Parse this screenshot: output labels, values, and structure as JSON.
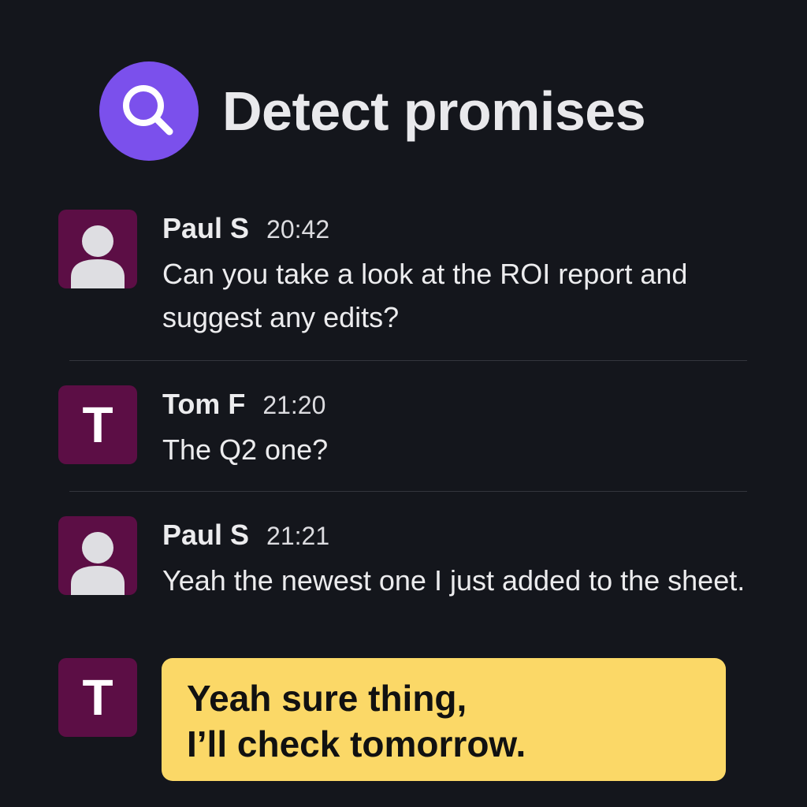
{
  "header": {
    "title": "Detect promises",
    "icon": "search-icon",
    "icon_bg_color": "#7b50ec"
  },
  "messages": [
    {
      "author": "Paul S",
      "time": "20:42",
      "text": "Can you take a look at the ROI report and suggest any edits?",
      "avatar": "person-icon"
    },
    {
      "author": "Tom F",
      "time": "21:20",
      "text": "The Q2 one?",
      "avatar_initial": "T"
    },
    {
      "author": "Paul S",
      "time": "21:21",
      "text": "Yeah the newest one I just added to the sheet.",
      "avatar": "person-icon"
    }
  ],
  "highlight": {
    "avatar_initial": "T",
    "line1": "Yeah sure thing,",
    "line2": "I’ll check tomorrow.",
    "color": "#fbd867"
  },
  "colors": {
    "background": "#14161c",
    "avatar_bg": "#5c0e45"
  }
}
